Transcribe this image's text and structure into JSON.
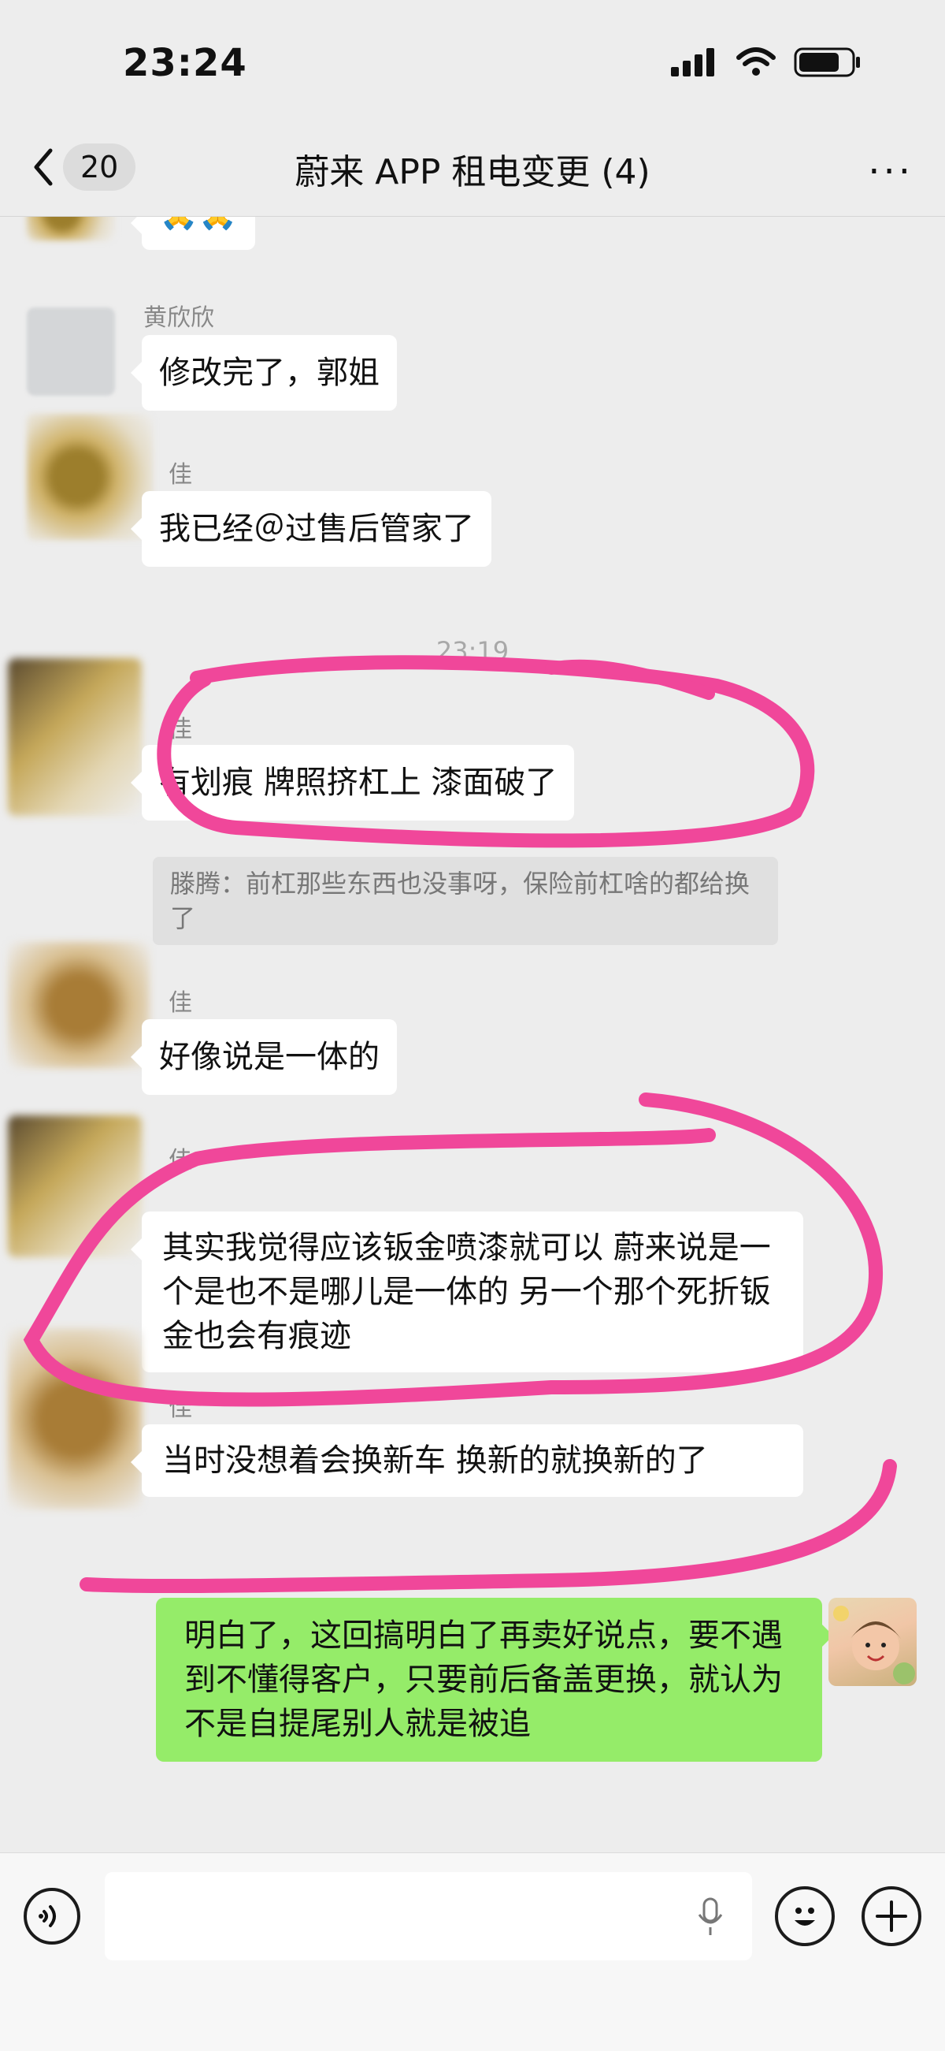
{
  "status_bar": {
    "time": "23:24"
  },
  "nav": {
    "back_count": "20",
    "title": "蔚来 APP 租电变更 (4)",
    "more": "···"
  },
  "messages": {
    "m0_text": "🙏🙏",
    "m1_sender": "黄欣欣",
    "m1_text": "修改完了，郭姐",
    "m2_sender": "佳",
    "m2_text": "我已经＠过售后管家了",
    "timestamp": "23:19",
    "m3_sender": "佳",
    "m3_text": "有划痕 牌照挤杠上 漆面破了",
    "m3_quote": "滕腾：前杠那些东西也没事呀，保险前杠啥的都给换了",
    "m4_sender": "佳",
    "m4_text": "好像说是一体的",
    "m5_sender": "佳",
    "m5_text": "其实我觉得应该钣金喷漆就可以 蔚来说是一个是也不是哪儿是一体的 另一个那个死折钣金也会有痕迹",
    "m6_sender": "佳",
    "m6_text": "当时没想着会换新车 换新的就换新的了",
    "m7_text": "明白了，这回搞明白了再卖好说点，要不遇到不懂得客户，只要前后备盖更换，就认为不是自提尾别人就是被追"
  },
  "input_bar": {
    "voice_icon": "voice-icon",
    "mic_icon": "mic-icon",
    "emoji_icon": "emoji-icon",
    "plus_icon": "plus-icon"
  },
  "colors": {
    "background": "#ededed",
    "my_bubble": "#95ec69",
    "annotation": "#f0479a"
  }
}
